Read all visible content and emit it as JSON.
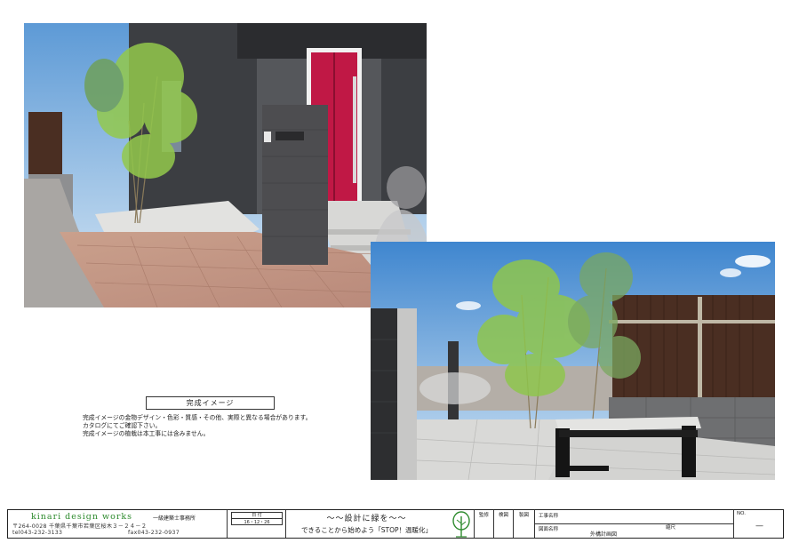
{
  "caption": {
    "title": "完成イメージ",
    "notes": [
      "完成イメージの金物デザイン・色彩・質感・その他、実際と異なる場合があります。",
      "カタログにてご確認下さい。",
      "完成イメージの植栽は本工事には含みません。"
    ]
  },
  "title_block": {
    "brand_name": "kinari design works",
    "office_type": "一級建築士事務所",
    "address": "〒264-0028 千葉県千葉市若葉区桜木３－２４－２",
    "phone": "tel043-232-3133",
    "fax": "fax043-232-0937",
    "date_label": "日 付",
    "date_value": "16・12・26",
    "slogan_main": "〜〜設計に緑を〜〜",
    "slogan_sub": "できることから始めよう「STOP！温暖化」",
    "stamps": [
      "監修",
      "検図",
      "製図"
    ],
    "project_label": "工事名称",
    "drawing_label": "図面名称",
    "scale_label": "縮尺",
    "drawing_name": "外構計画図",
    "no_label": "NO.",
    "no_value": "—"
  },
  "colors": {
    "brand_green": "#2e8b2e",
    "door_red": "#c01845",
    "wall_dark": "#3c3e42"
  }
}
